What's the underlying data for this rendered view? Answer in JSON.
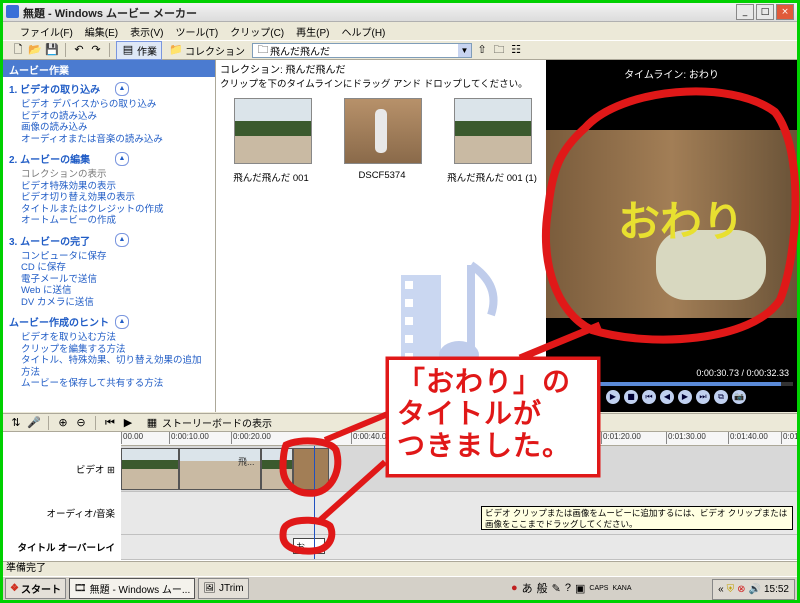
{
  "window": {
    "title": "無題 - Windows ムービー メーカー",
    "controls": {
      "minimize": "_",
      "maximize": "□",
      "close": "×"
    }
  },
  "menubar": {
    "items": [
      "ファイル(F)",
      "編集(E)",
      "表示(V)",
      "ツール(T)",
      "クリップ(C)",
      "再生(P)",
      "ヘルプ(H)"
    ]
  },
  "toolbar": {
    "work_label": "作業",
    "collection_label": "コレクション",
    "collection_value": "飛んだ飛んだ"
  },
  "task_pane": {
    "header": "ムービー作業",
    "sections": [
      {
        "title": "1. ビデオの取り込み",
        "links": [
          {
            "text": "ビデオ デバイスからの取り込み",
            "enabled": true
          },
          {
            "text": "ビデオの読み込み",
            "enabled": true
          },
          {
            "text": "画像の読み込み",
            "enabled": true
          },
          {
            "text": "オーディオまたは音楽の読み込み",
            "enabled": true
          }
        ]
      },
      {
        "title": "2. ムービーの編集",
        "links": [
          {
            "text": "コレクションの表示",
            "enabled": false
          },
          {
            "text": "ビデオ特殊効果の表示",
            "enabled": true
          },
          {
            "text": "ビデオ切り替え効果の表示",
            "enabled": true
          },
          {
            "text": "タイトルまたはクレジットの作成",
            "enabled": true
          },
          {
            "text": "オートムービーの作成",
            "enabled": true
          }
        ]
      },
      {
        "title": "3. ムービーの完了",
        "links": [
          {
            "text": "コンピュータに保存",
            "enabled": true
          },
          {
            "text": "CD に保存",
            "enabled": true
          },
          {
            "text": "電子メールで送信",
            "enabled": true
          },
          {
            "text": "Web に送信",
            "enabled": true
          },
          {
            "text": "DV カメラに送信",
            "enabled": true
          }
        ]
      },
      {
        "title": "ムービー作成のヒント",
        "links": [
          {
            "text": "ビデオを取り込む方法",
            "enabled": true
          },
          {
            "text": "クリップを編集する方法",
            "enabled": true
          },
          {
            "text": "タイトル、特殊効果、切り替え効果の追加方法",
            "enabled": true
          },
          {
            "text": "ムービーを保存して共有する方法",
            "enabled": true
          }
        ]
      }
    ]
  },
  "collection": {
    "title": "コレクション: 飛んだ飛んだ",
    "description": "クリップを下のタイムラインにドラッグ アンド ドロップしてください。",
    "items": [
      {
        "label": "飛んだ飛んだ 001",
        "kind": "outdoor"
      },
      {
        "label": "DSCF5374",
        "kind": "indoor"
      },
      {
        "label": "飛んだ飛んだ 001 (1)",
        "kind": "outdoor"
      }
    ]
  },
  "preview": {
    "title": "タイムライン: おわり",
    "overlay_text": "おわり",
    "time": "0:00:30.73 / 0:00:32.33",
    "progress": 0.95
  },
  "timeline_toolbar": {
    "storyboard_label": "ストーリーボードの表示"
  },
  "timeline": {
    "ruler": [
      "00.00",
      "0:00:10.00",
      "0:00:20.00",
      "0:00:40.00",
      "0:01:20.00",
      "0:01:30.00",
      "0:01:40.00",
      "0:01:50.00"
    ],
    "tracks": {
      "video": "ビデオ",
      "audio": "オーディオ/音楽",
      "title": "タイトル オーバーレイ"
    },
    "clip_label": "飛...",
    "title_clip": "お...",
    "tooltip": "ビデオ クリップまたは画像をムービーに追加するには、ビデオ クリップまたは画像をここまでドラッグしてください。"
  },
  "statusbar": {
    "text": "準備完了"
  },
  "taskbar": {
    "start": "スタート",
    "tasks": [
      "無題 - Windows ムー...",
      "JTrim"
    ],
    "ime": [
      "あ",
      "般"
    ],
    "tray_labels": [
      "CAPS",
      "KANA"
    ],
    "clock": "15:52"
  },
  "annotation": {
    "text": "「おわり」の\nタイトルが\nつきました。",
    "color": "#e01818"
  }
}
